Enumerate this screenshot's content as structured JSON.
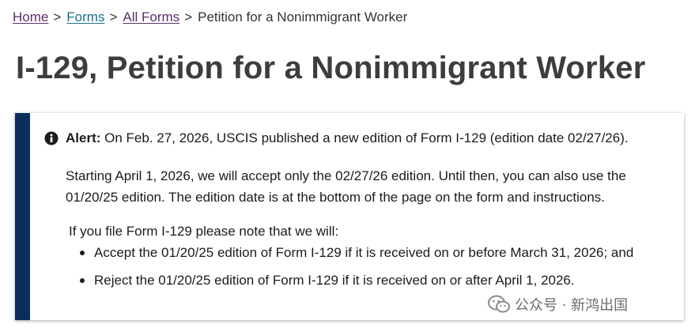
{
  "breadcrumb": {
    "items": [
      "Home",
      "Forms",
      "All Forms"
    ],
    "separator": ">",
    "current": "Petition for a Nonimmigrant Worker"
  },
  "page_title": "I-129, Petition for a Nonimmigrant Worker",
  "alert": {
    "icon": "info-circle-icon",
    "label": "Alert:",
    "line1": "On Feb. 27, 2026, USCIS published a new edition of Form I-129 (edition date 02/27/26).",
    "para2": "Starting April 1, 2026, we will accept only the 02/27/26 edition. Until then, you can also use the 01/20/25 edition. The edition date is at the bottom of the page on the form and instructions.",
    "para3": "If you file Form I-129 please note that we will:",
    "list": [
      "Accept the 01/20/25 edition of Form I-129 if it is received on or before March 31, 2026; and",
      "Reject the 01/20/25 edition of Form I-129 if it is received on or after April 1, 2026."
    ]
  },
  "watermark": {
    "icon": "wechat-logo",
    "text": "公众号 · 新鸿出国"
  },
  "colors": {
    "alert_bar": "#0b2e5c",
    "title": "#3d3d3d",
    "link_visited": "#5b2d6b",
    "link": "#1a6f8a"
  }
}
